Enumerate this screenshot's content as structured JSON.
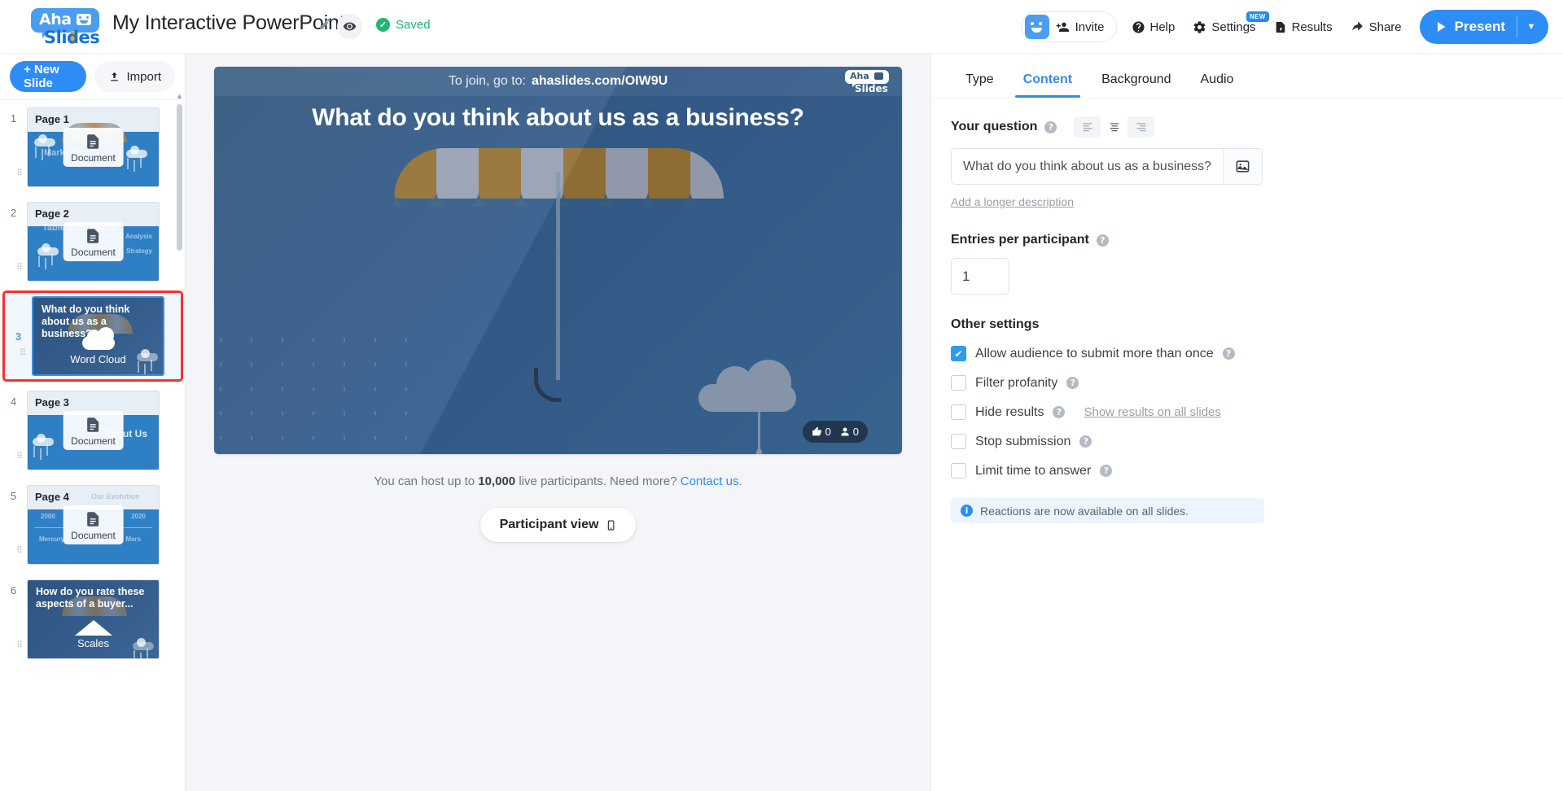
{
  "header": {
    "logo": {
      "aha": "Aha",
      "slides": "Slides"
    },
    "doc_title": "My Interactive PowerPoint",
    "edit_icon": "pencil-icon",
    "preview_icon": "eye-icon",
    "saved_label": "Saved",
    "saved_color": "#21b573",
    "invite_label": "Invite",
    "help_label": "Help",
    "settings_label": "Settings",
    "settings_badge": "NEW",
    "results_label": "Results",
    "share_label": "Share",
    "present_label": "Present",
    "present_caret": "▼",
    "accent_color": "#2d8cf5"
  },
  "sidebar": {
    "new_slide_label": "+ New Slide",
    "import_label": "Import",
    "slides": [
      {
        "num": "1",
        "kind": "document",
        "title": "Page 1",
        "overlay": "Document",
        "ghost": "Marketing"
      },
      {
        "num": "2",
        "kind": "document",
        "title": "Page 2",
        "overlay": "Document",
        "ghost": "Table of contents"
      },
      {
        "num": "3",
        "kind": "wordcloud",
        "title": "What do you think about us as a business?",
        "type_label": "Word Cloud",
        "selected": true
      },
      {
        "num": "4",
        "kind": "document",
        "title": "Page 3",
        "overlay": "Document",
        "ghost": "About Us"
      },
      {
        "num": "5",
        "kind": "document",
        "title": "Page 4",
        "overlay": "Document",
        "ghost": "Our Evolution"
      },
      {
        "num": "6",
        "kind": "scales",
        "title": "How do you rate these aspects of a buyer...",
        "type_label": "Scales"
      }
    ]
  },
  "stage": {
    "join_prefix": "To join, go to:",
    "join_code": "ahaslides.com/OIW9U",
    "watermark": {
      "aha": "Aha",
      "slides": "Slides"
    },
    "question": "What do you think about us as a business?",
    "reaction_thumbs_count": "0",
    "reaction_people_count": "0"
  },
  "below_stage": {
    "host_note_prefix": "You can host up to",
    "host_note_number": "10,000",
    "host_note_middle": "live participants. Need more?",
    "contact_link": "Contact us",
    "host_note_suffix": ".",
    "participant_view_label": "Participant view"
  },
  "panel": {
    "tabs": [
      {
        "label": "Type",
        "active": false
      },
      {
        "label": "Content",
        "active": true
      },
      {
        "label": "Background",
        "active": false
      },
      {
        "label": "Audio",
        "active": false
      }
    ],
    "question_label": "Your question",
    "question_value": "What do you think about us as a business?",
    "align_left_icon": "align-left-icon",
    "align_center_icon": "align-center-icon",
    "align_right_icon": "align-right-icon",
    "image_button_icon": "image-icon",
    "longer_description_link": "Add a longer description",
    "entries_label": "Entries per participant",
    "entries_value": "1",
    "other_settings_label": "Other settings",
    "checkboxes": [
      {
        "label": "Allow audience to submit more than once",
        "checked": true,
        "help": true
      },
      {
        "label": "Filter profanity",
        "checked": false,
        "help": true
      },
      {
        "label": "Hide results",
        "checked": false,
        "help": true,
        "link": "Show results on all slides"
      },
      {
        "label": "Stop submission",
        "checked": false,
        "help": true
      },
      {
        "label": "Limit time to answer",
        "checked": false,
        "help": true
      }
    ],
    "info_text": "Reactions are now available on all slides.",
    "help_glyph": "?"
  }
}
